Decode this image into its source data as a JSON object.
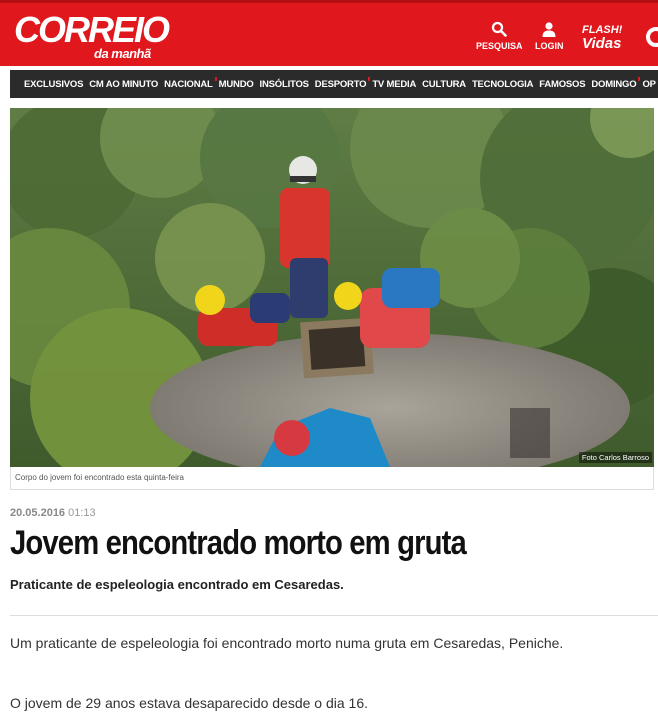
{
  "header": {
    "logo_main": "CORREIO",
    "logo_sub": "da manhã",
    "search_label": "PESQUISA",
    "login_label": "LOGIN",
    "flash_line1": "FLASH!",
    "flash_line2": "Vidas",
    "brand_color": "#e0181e"
  },
  "nav": {
    "items": [
      {
        "label": "EXCLUSIVOS",
        "dot": false
      },
      {
        "label": "CM AO MINUTO",
        "dot": false
      },
      {
        "label": "NACIONAL",
        "dot": true
      },
      {
        "label": "MUNDO",
        "dot": false
      },
      {
        "label": "INSÓLITOS",
        "dot": false
      },
      {
        "label": "DESPORTO",
        "dot": true
      },
      {
        "label": "TV MEDIA",
        "dot": false
      },
      {
        "label": "CULTURA",
        "dot": false
      },
      {
        "label": "TECNOLOGIA",
        "dot": false
      },
      {
        "label": "FAMOSOS",
        "dot": false
      },
      {
        "label": "DOMINGO",
        "dot": true
      },
      {
        "label": "OP",
        "dot": false
      }
    ]
  },
  "article": {
    "image_caption": "Corpo do jovem foi encontrado esta quinta-feira",
    "image_credit": "Foto Carlos Barroso",
    "date": "20.05.2016",
    "time": "01:13",
    "title": "Jovem encontrado morto em gruta",
    "lead": "Praticante de espeleologia encontrado em Cesaredas.",
    "paragraphs": [
      "Um praticante de espeleologia foi encontrado morto numa gruta em Cesaredas, Peniche.",
      "O jovem de 29 anos estava desaparecido desde o dia 16."
    ]
  }
}
